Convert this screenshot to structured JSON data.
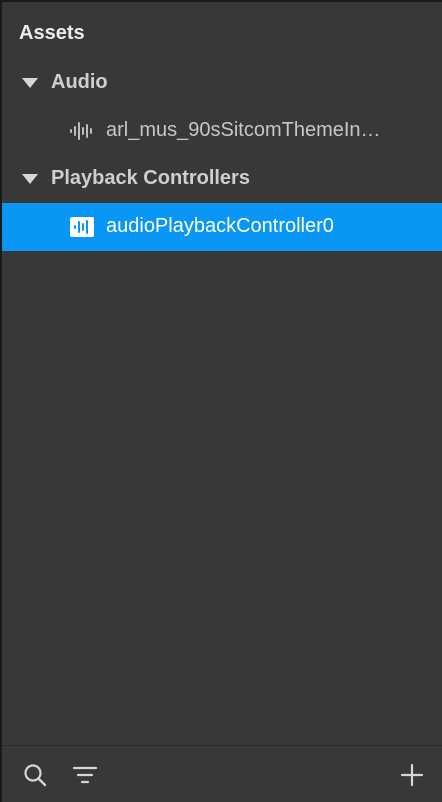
{
  "panel": {
    "title": "Assets"
  },
  "tree": {
    "groups": [
      {
        "label": "Audio",
        "expanded": true,
        "items": [
          {
            "label": "arl_mus_90sSitcomThemeIn…",
            "icon": "audio-waveform-icon",
            "selected": false
          }
        ]
      },
      {
        "label": "Playback Controllers",
        "expanded": true,
        "items": [
          {
            "label": "audioPlaybackController0",
            "icon": "playback-controller-icon",
            "selected": true
          }
        ]
      }
    ]
  },
  "footer": {
    "icons": [
      "search-icon",
      "filter-icon",
      "add-icon"
    ]
  },
  "colors": {
    "panel_bg": "#383838",
    "selection": "#0a96f5",
    "text": "#cfcfcf"
  }
}
